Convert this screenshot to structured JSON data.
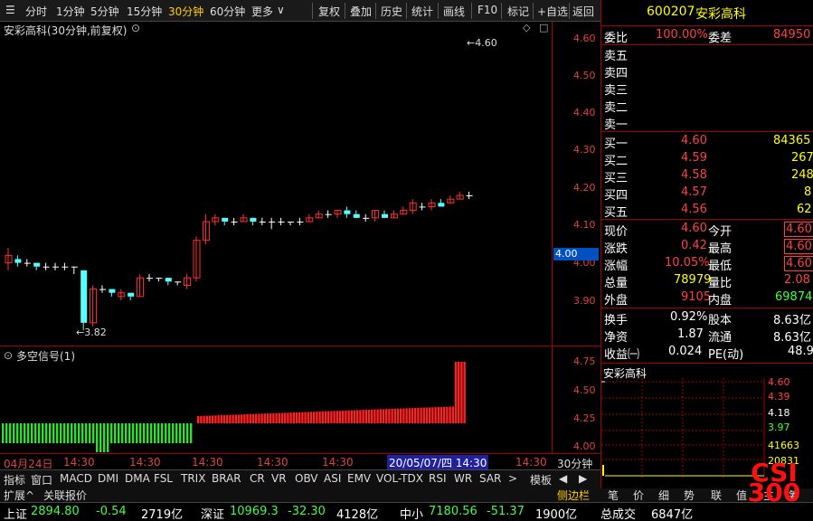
{
  "toolbar": {
    "menu_icon": "hamburger-icon",
    "periods": [
      "分时",
      "1分钟",
      "5分钟",
      "15分钟",
      "30分钟",
      "60分钟",
      "更多"
    ],
    "active_period": "30分钟",
    "actions": [
      "复权",
      "叠加",
      "历史",
      "统计",
      "画线",
      "F10",
      "标记",
      "+自选",
      "返回"
    ]
  },
  "chart": {
    "title": "安彩高科(30分钟,前复权)",
    "max_label": "4.60",
    "min_label": "3.82",
    "current_price_tag": "4.00",
    "y_ticks": [
      "4.60",
      "4.50",
      "4.40",
      "4.30",
      "4.20",
      "4.10",
      "4.00",
      "3.90"
    ],
    "x_labels": [
      "04月24日",
      "14:30",
      "14:30",
      "14:30",
      "14:30",
      "14:30",
      "14:30",
      "14:30",
      "14:30"
    ],
    "cursor_date": "20/05/07/四 14:30",
    "period_tag": "30分钟"
  },
  "indicator": {
    "title": "多空信号(1)",
    "y_ticks": [
      "4.75",
      "4.50",
      "4.25",
      "4.00"
    ]
  },
  "chart_data": {
    "type": "bar",
    "title": "多空信号(1)",
    "note_series": "green bars negative, red bars positive",
    "values": [
      -1,
      -1,
      -1,
      -1,
      -1,
      -1,
      -1,
      -1,
      -1,
      -1,
      -1,
      -1,
      -1,
      -1,
      -1,
      -1,
      -1,
      -1,
      -1,
      -1,
      -1,
      -1,
      -1,
      -1,
      -1,
      -1,
      -1,
      -1,
      -1,
      -1,
      -1,
      -1,
      -1,
      -1,
      -1,
      -1,
      -1,
      -1,
      -1,
      -1,
      -1,
      -1,
      -1,
      -1,
      -1,
      -1,
      -1,
      -1,
      -1,
      -1,
      -1,
      -1,
      -1,
      1,
      1,
      1,
      1,
      1,
      1,
      1,
      1,
      1,
      1,
      1,
      1,
      1,
      1,
      1,
      1,
      1,
      1,
      1,
      1,
      1,
      1,
      1,
      1,
      1,
      1,
      1,
      1,
      1,
      1,
      1,
      1,
      1,
      1,
      1,
      1,
      1,
      1,
      1,
      1,
      1,
      1,
      1,
      1,
      1,
      1,
      1,
      1,
      1,
      1,
      1,
      1,
      1,
      1,
      1,
      1,
      1,
      1,
      1,
      1,
      1,
      1,
      1,
      1,
      1,
      1,
      1,
      1,
      1,
      1,
      1,
      1,
      1,
      1,
      1,
      1,
      1,
      1,
      1,
      1,
      1,
      1,
      1,
      1,
      1,
      1,
      1,
      1,
      1,
      1,
      1,
      1,
      1
    ],
    "ylim": [
      4.0,
      4.75
    ]
  },
  "bottom_tabs": [
    "指标",
    "窗口",
    "MACD",
    "DMI",
    "DMA",
    "FSL",
    "TRIX",
    "BRAR",
    "CR",
    "VR",
    "OBV",
    "ASI",
    "EMV",
    "VOL-TDX",
    "RSI",
    "WR",
    "SAR",
    ">",
    "模板"
  ],
  "bottom_tabs2_left": [
    "扩展^",
    "关联报价"
  ],
  "bottom_tabs2_right": [
    "侧边栏",
    "笔",
    "价",
    "细",
    "势",
    "联",
    "值",
    "主",
    "筹"
  ],
  "quote": {
    "code": "600207",
    "name": "安彩高科",
    "weibi_label": "委比",
    "weibi": "100.00%",
    "weicha_label": "委差",
    "weicha": "84950",
    "sell": [
      {
        "label": "卖五",
        "price": "",
        "vol": ""
      },
      {
        "label": "卖四",
        "price": "",
        "vol": ""
      },
      {
        "label": "卖三",
        "price": "",
        "vol": ""
      },
      {
        "label": "卖二",
        "price": "",
        "vol": ""
      },
      {
        "label": "卖一",
        "price": "",
        "vol": ""
      }
    ],
    "buy": [
      {
        "label": "买一",
        "price": "4.60",
        "vol": "84365"
      },
      {
        "label": "买二",
        "price": "4.59",
        "vol": "267"
      },
      {
        "label": "买三",
        "price": "4.58",
        "vol": "248"
      },
      {
        "label": "买四",
        "price": "4.57",
        "vol": "8"
      },
      {
        "label": "买五",
        "price": "4.56",
        "vol": "62"
      }
    ],
    "stats": [
      {
        "l1": "现价",
        "v1": "4.60",
        "l2": "今开",
        "v2": "4.60"
      },
      {
        "l1": "涨跌",
        "v1": "0.42",
        "l2": "最高",
        "v2": "4.60"
      },
      {
        "l1": "涨幅",
        "v1": "10.05%",
        "l2": "最低",
        "v2": "4.60"
      },
      {
        "l1": "总量",
        "v1": "78979",
        "l2": "量比",
        "v2": "2.08"
      },
      {
        "l1": "外盘",
        "v1": "9105",
        "l2": "内盘",
        "v2": "69874"
      }
    ],
    "stats2": [
      {
        "l1": "换手",
        "v1": "0.92%",
        "l2": "股本",
        "v2": "8.63亿"
      },
      {
        "l1": "净资",
        "v1": "1.87",
        "l2": "流通",
        "v2": "8.63亿"
      },
      {
        "l1": "收益㈠",
        "v1": "0.024",
        "l2": "PE(动)",
        "v2": "48.9"
      }
    ],
    "mini_title": "安彩高科",
    "mini_ticks": [
      "4.60",
      "4.39",
      "4.18",
      "3.97",
      "41663",
      "20831"
    ]
  },
  "statusbar": {
    "items": [
      {
        "label": "上证",
        "value": "2894.80",
        "change": "-0.54",
        "amount": "2719亿"
      },
      {
        "label": "深证",
        "value": "10969.3",
        "change": "-32.30",
        "amount": "4128亿"
      },
      {
        "label": "中小",
        "value": "7180.56",
        "change": "-51.37",
        "amount": "1900亿"
      }
    ],
    "total_label": "总成交",
    "total_value": "6847亿"
  },
  "watermark": "CSI 300",
  "colors": {
    "up": "#ff3030",
    "down": "#54ffff",
    "panel_border": "#a00000"
  }
}
